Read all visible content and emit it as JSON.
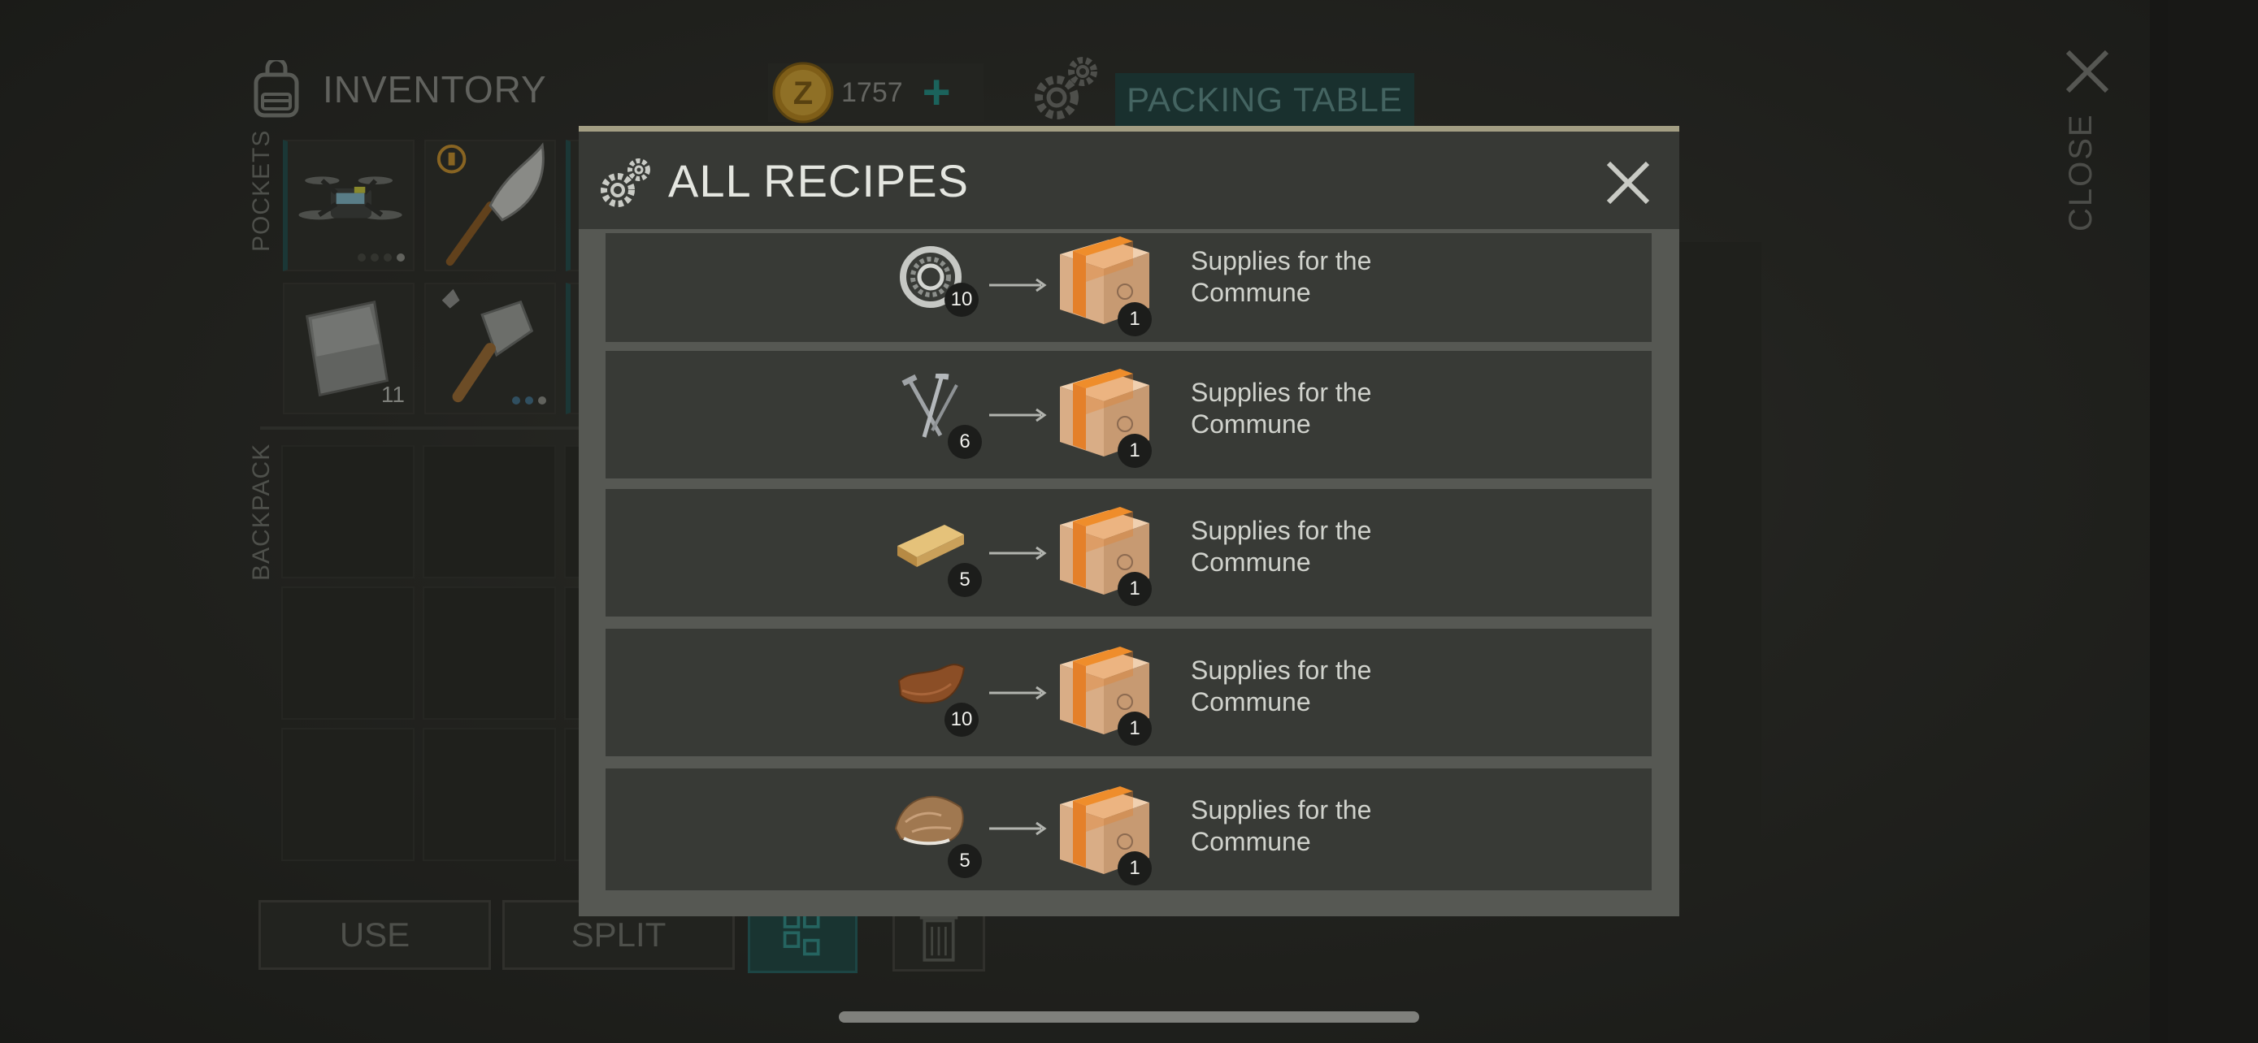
{
  "inventory": {
    "title": "INVENTORY",
    "pockets_label": "POCKETS",
    "backpack_label": "BACKPACK",
    "pocket_slots": [
      {
        "item": "drone",
        "count": ""
      },
      {
        "item": "curved-blade",
        "count": ""
      },
      {
        "item": "metal-sheet",
        "count": "11"
      },
      {
        "item": "cleaver",
        "count": ""
      }
    ]
  },
  "currency": {
    "amount": "1757",
    "add_label": "+"
  },
  "station": {
    "name": "PACKING TABLE"
  },
  "close_label": "CLOSE",
  "buttons": {
    "use": "USE",
    "split": "SPLIT"
  },
  "modal": {
    "title": "ALL RECIPES",
    "recipes": [
      {
        "ingredient_icon": "bearing-icon",
        "ingredient_qty": "10",
        "result_qty": "1",
        "result_name": "Supplies for the Commune"
      },
      {
        "ingredient_icon": "nails-icon",
        "ingredient_qty": "6",
        "result_qty": "1",
        "result_name": "Supplies for the Commune"
      },
      {
        "ingredient_icon": "plank-icon",
        "ingredient_qty": "5",
        "result_qty": "1",
        "result_name": "Supplies for the Commune"
      },
      {
        "ingredient_icon": "leather-icon",
        "ingredient_qty": "10",
        "result_qty": "1",
        "result_name": "Supplies for the Commune"
      },
      {
        "ingredient_icon": "fur-icon",
        "ingredient_qty": "5",
        "result_qty": "1",
        "result_name": "Supplies for the Commune"
      }
    ]
  },
  "colors": {
    "accent_teal": "#1f8e84",
    "modal_bg": "#383a36",
    "coin_gold": "#c9961f"
  }
}
